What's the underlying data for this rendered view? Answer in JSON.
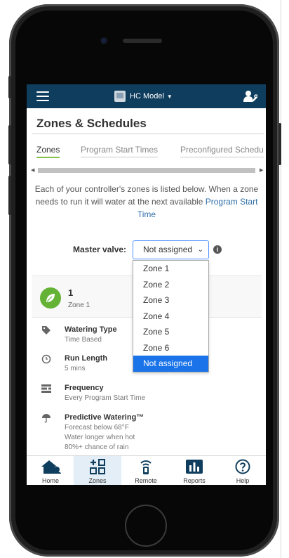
{
  "header": {
    "model": "HC Model"
  },
  "page": {
    "title": "Zones & Schedules"
  },
  "tabs": [
    {
      "label": "Zones",
      "active": true
    },
    {
      "label": "Program Start Times",
      "active": false
    },
    {
      "label": "Preconfigured Schedu",
      "active": false
    }
  ],
  "intro": {
    "text": "Each of your controller's zones is listed below. When a zone needs to run it will water at the next available ",
    "link": "Program Start Time"
  },
  "master_valve": {
    "label": "Master valve:",
    "value": "Not assigned",
    "options": [
      "Zone 1",
      "Zone 2",
      "Zone 3",
      "Zone 4",
      "Zone 5",
      "Zone 6",
      "Not assigned"
    ],
    "selected_index": 6
  },
  "zone": {
    "number": "1",
    "name": "Zone 1",
    "rows": [
      {
        "icon": "tag-icon",
        "title": "Watering Type",
        "lines": [
          "Time Based"
        ]
      },
      {
        "icon": "clock-icon",
        "title": "Run Length",
        "lines": [
          "5 mins"
        ]
      },
      {
        "icon": "calendar-icon",
        "title": "Frequency",
        "lines": [
          "Every Program Start Time"
        ]
      },
      {
        "icon": "umbrella-icon",
        "title": "Predictive Watering™",
        "lines": [
          "Forecast below 68°F",
          "Water longer when hot",
          "80%+ chance of rain"
        ]
      }
    ]
  },
  "nav": [
    {
      "label": "Home",
      "icon": "home-icon",
      "active": false
    },
    {
      "label": "Zones",
      "icon": "zones-icon",
      "active": true
    },
    {
      "label": "Remote",
      "icon": "remote-icon",
      "active": false
    },
    {
      "label": "Reports",
      "icon": "reports-icon",
      "active": false
    },
    {
      "label": "Help",
      "icon": "help-icon",
      "active": false
    }
  ],
  "colors": {
    "header": "#0f3d5d",
    "accent": "#7fc245",
    "link": "#2f6fa8",
    "selected": "#1a73e8"
  }
}
